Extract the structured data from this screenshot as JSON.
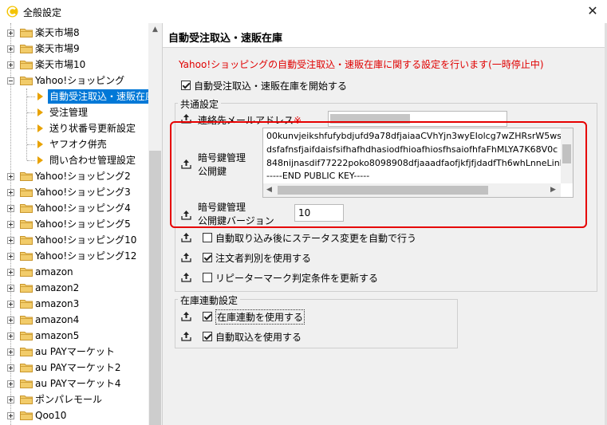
{
  "window": {
    "title": "全般設定",
    "close_icon": "close-icon"
  },
  "tree": {
    "items": [
      {
        "label": "楽天市場8"
      },
      {
        "label": "楽天市場9"
      },
      {
        "label": "楽天市場10"
      },
      {
        "label": "Yahoo!ショッピング"
      },
      {
        "label": "自動受注取込・速販在庫"
      },
      {
        "label": "受注管理"
      },
      {
        "label": "送り状番号更新設定"
      },
      {
        "label": "ヤフオク併売"
      },
      {
        "label": "問い合わせ管理設定"
      },
      {
        "label": "Yahoo!ショッピング2"
      },
      {
        "label": "Yahoo!ショッピング3"
      },
      {
        "label": "Yahoo!ショッピング4"
      },
      {
        "label": "Yahoo!ショッピング5"
      },
      {
        "label": "Yahoo!ショッピング10"
      },
      {
        "label": "Yahoo!ショッピング12"
      },
      {
        "label": "amazon"
      },
      {
        "label": "amazon2"
      },
      {
        "label": "amazon3"
      },
      {
        "label": "amazon4"
      },
      {
        "label": "amazon5"
      },
      {
        "label": "au PAYマーケット"
      },
      {
        "label": "au PAYマーケット2"
      },
      {
        "label": "au PAYマーケット4"
      },
      {
        "label": "ポンパレモール"
      },
      {
        "label": "Qoo10"
      }
    ]
  },
  "panel": {
    "title": "自動受注取込・速販在庫",
    "description": "Yahoo!ショッピングの自動受注取込・速販在庫に関する設定を行います(一時停止中)",
    "enable_checkbox": {
      "label": "自動受注取込・速販在庫を開始する",
      "checked": true
    },
    "common_group": {
      "title": "共通設定",
      "email_label": "連絡先メールアドレス",
      "required_mark": "※",
      "public_key_label_1": "暗号鍵管理",
      "public_key_label_2": "公開鍵",
      "public_key_lines": [
        "00kunvjeikshfufybdjufd9a78dfjaiaaCVhYjn3wyEIolcg7wZHRsrW5ws",
        "dsfafnsfjaifdaisfsifhafhdhasiodfhioafhiosfhsaiofhfaFhMLYA7K68V0c",
        "848nijnasdif77222poko8098908dfjaaadfaofjkfjfjdadfTh6whLnneLinF",
        "-----END PUBLIC KEY-----"
      ],
      "version_label_1": "暗号鍵管理",
      "version_label_2": "公開鍵バージョン",
      "version_value": "10",
      "options": [
        {
          "label": "自動取り込み後にステータス変更を自動で行う",
          "checked": false
        },
        {
          "label": "注文者判別を使用する",
          "checked": true
        },
        {
          "label": "リピーターマーク判定条件を更新する",
          "checked": false
        }
      ]
    },
    "inventory_group": {
      "title": "在庫連動設定",
      "options": [
        {
          "label": "在庫連動を使用する",
          "checked": true
        },
        {
          "label": "自動取込を使用する",
          "checked": true
        }
      ]
    }
  },
  "colors": {
    "accent": "#0078d7",
    "warning": "#e00000",
    "highlight": "#e60000",
    "folder": "#e8b84a"
  }
}
